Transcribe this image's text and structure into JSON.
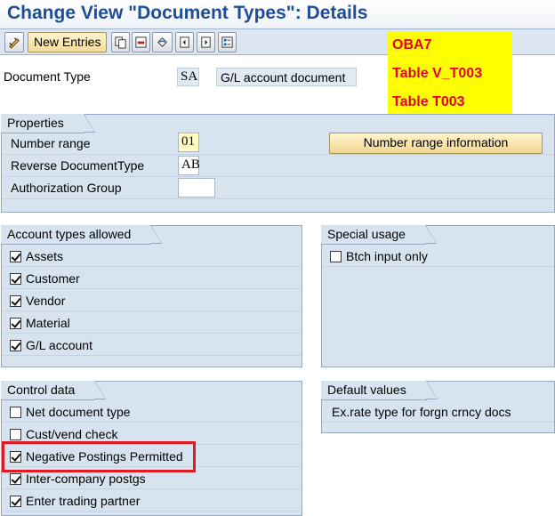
{
  "title": "Change View \"Document Types\": Details",
  "toolbar": {
    "new_entries": "New Entries",
    "icons": [
      "display-change-icon",
      "copy-icon",
      "delete-icon",
      "undo-icon",
      "previous-entry-icon",
      "next-entry-icon",
      "select-all-icon"
    ]
  },
  "annotation": {
    "line1": "OBA7",
    "line2": "Table V_T003",
    "line3": "Table T003"
  },
  "header": {
    "doc_type_label": "Document Type",
    "doc_type_value": "SA",
    "doc_type_desc": "G/L account document"
  },
  "properties": {
    "title": "Properties",
    "number_range_label": "Number range",
    "number_range_value": "01",
    "reverse_label": "Reverse DocumentType",
    "reverse_value": "AB",
    "auth_label": "Authorization Group",
    "auth_value": "",
    "nr_info_button": "Number range information"
  },
  "account_types": {
    "title": "Account types allowed",
    "items": [
      {
        "label": "Assets",
        "checked": true
      },
      {
        "label": "Customer",
        "checked": true
      },
      {
        "label": "Vendor",
        "checked": true
      },
      {
        "label": "Material",
        "checked": true
      },
      {
        "label": "G/L account",
        "checked": true
      }
    ]
  },
  "special_usage": {
    "title": "Special usage",
    "items": [
      {
        "label": "Btch input only",
        "checked": false
      }
    ]
  },
  "control_data": {
    "title": "Control data",
    "items": [
      {
        "label": "Net document type",
        "checked": false
      },
      {
        "label": "Cust/vend check",
        "checked": false
      },
      {
        "label": "Negative Postings Permitted",
        "checked": true
      },
      {
        "label": "Inter-company postgs",
        "checked": true
      },
      {
        "label": "Enter trading partner",
        "checked": true
      }
    ]
  },
  "default_values": {
    "title": "Default values",
    "exrate_label": "Ex.rate type for forgn crncy docs"
  },
  "colors": {
    "title": "#1f4e96",
    "annotation_bg": "#ffff00",
    "annotation_text": "#e8002a",
    "highlight_box": "#e21a24",
    "group_bg": "#d7e3ef"
  }
}
